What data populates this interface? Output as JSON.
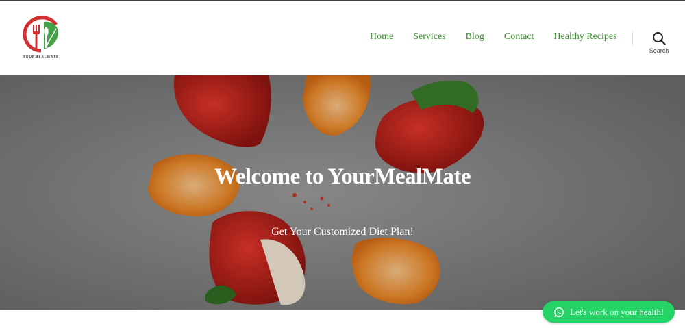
{
  "brand": {
    "logo_text": "YOURMEALMATE",
    "colors": {
      "red": "#d32f2f",
      "green": "#43a047"
    }
  },
  "nav": {
    "items": [
      {
        "label": "Home"
      },
      {
        "label": "Services"
      },
      {
        "label": "Blog"
      },
      {
        "label": "Contact"
      },
      {
        "label": "Healthy Recipes"
      }
    ],
    "color": "#3a8a2e"
  },
  "search": {
    "label": "Search",
    "icon": "search-icon"
  },
  "hero": {
    "title": "Welcome to YourMealMate",
    "subtitle": "Get Your Customized Diet Plan!"
  },
  "whatsapp": {
    "label": "Let's work on your health!",
    "icon": "whatsapp-icon",
    "color": "#25d366"
  }
}
